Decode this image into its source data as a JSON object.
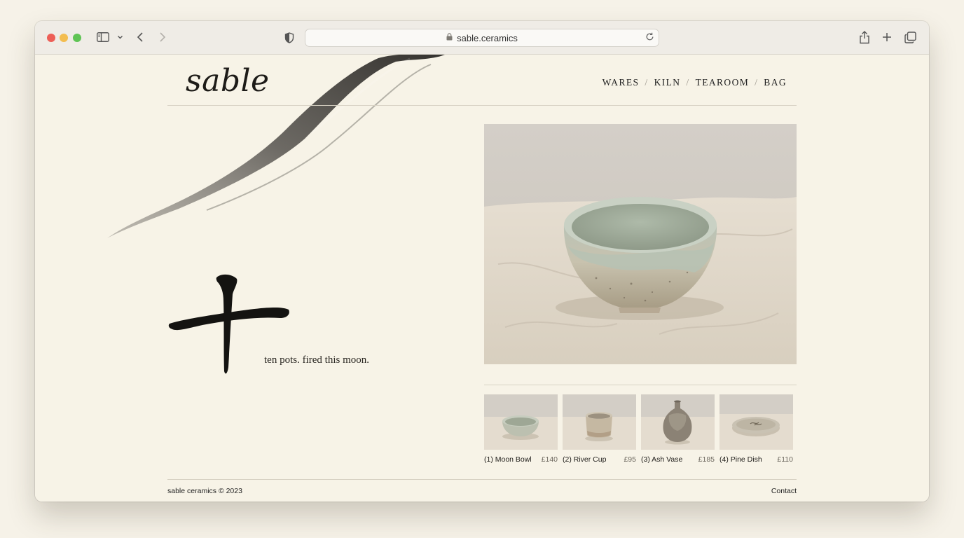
{
  "browser": {
    "url": "sable.ceramics"
  },
  "site": {
    "logo": "sable",
    "nav": [
      "WARES",
      "KILN",
      "TEAROOM",
      "BAG"
    ],
    "nav_separator": "/",
    "kanji": "十",
    "tagline": "ten pots. fired this moon."
  },
  "products": [
    {
      "name": "(1) Moon Bowl",
      "price": "£140"
    },
    {
      "name": "(2) River Cup",
      "price": "£95"
    },
    {
      "name": "(3) Ash Vase",
      "price": "£185"
    },
    {
      "name": "(4) Pine Dish",
      "price": "£110"
    }
  ],
  "footer": {
    "copyright": "sable ceramics © 2023",
    "contact": "Contact"
  },
  "colors": {
    "page_background": "#f7f3e7",
    "ink": "#1d1b18",
    "rule": "#d8d2c4",
    "close": "#ed5f57",
    "minimize": "#f3bd4f",
    "zoom": "#5fc454"
  }
}
